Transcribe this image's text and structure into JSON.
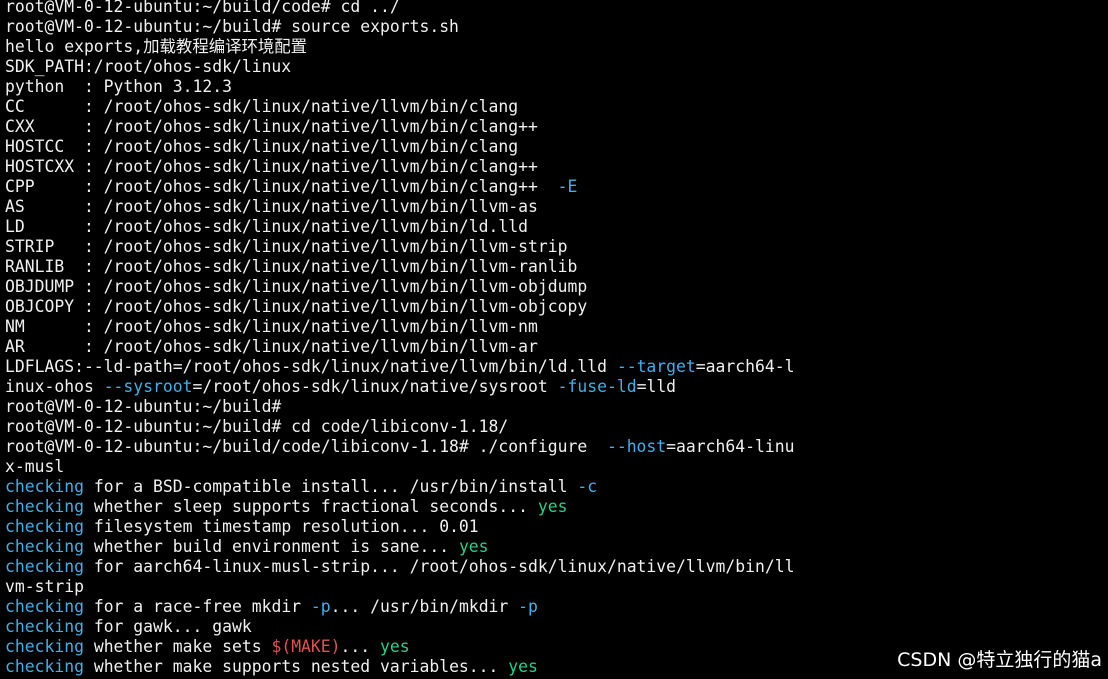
{
  "colors": {
    "background": "#000000",
    "text": "#f0f0f0",
    "option_flag": "#3fb0e8",
    "checking": "#3fb0e8",
    "yes_result": "#23d18b",
    "make_var": "#e05252"
  },
  "terminal": {
    "lines": [
      [
        {
          "t": "root@VM-0-12-ubuntu:~/build/code# cd ../",
          "c": "white"
        }
      ],
      [
        {
          "t": "root@VM-0-12-ubuntu:~/build# source exports.sh",
          "c": "white"
        }
      ],
      [
        {
          "t": "hello exports,加载教程编译环境配置",
          "c": "white"
        }
      ],
      [
        {
          "t": "SDK_PATH:/root/ohos-sdk/linux",
          "c": "white"
        }
      ],
      [
        {
          "t": "python  : Python 3.12.3",
          "c": "white"
        }
      ],
      [
        {
          "t": "CC      : /root/ohos-sdk/linux/native/llvm/bin/clang",
          "c": "white"
        }
      ],
      [
        {
          "t": "CXX     : /root/ohos-sdk/linux/native/llvm/bin/clang++",
          "c": "white"
        }
      ],
      [
        {
          "t": "HOSTCC  : /root/ohos-sdk/linux/native/llvm/bin/clang",
          "c": "white"
        }
      ],
      [
        {
          "t": "HOSTCXX : /root/ohos-sdk/linux/native/llvm/bin/clang++",
          "c": "white"
        }
      ],
      [
        {
          "t": "CPP     : /root/ohos-sdk/linux/native/llvm/bin/clang++  ",
          "c": "white"
        },
        {
          "t": "-E",
          "c": "blue"
        }
      ],
      [
        {
          "t": "AS      : /root/ohos-sdk/linux/native/llvm/bin/llvm-as",
          "c": "white"
        }
      ],
      [
        {
          "t": "LD      : /root/ohos-sdk/linux/native/llvm/bin/ld.lld",
          "c": "white"
        }
      ],
      [
        {
          "t": "STRIP   : /root/ohos-sdk/linux/native/llvm/bin/llvm-strip",
          "c": "white"
        }
      ],
      [
        {
          "t": "RANLIB  : /root/ohos-sdk/linux/native/llvm/bin/llvm-ranlib",
          "c": "white"
        }
      ],
      [
        {
          "t": "OBJDUMP : /root/ohos-sdk/linux/native/llvm/bin/llvm-objdump",
          "c": "white"
        }
      ],
      [
        {
          "t": "OBJCOPY : /root/ohos-sdk/linux/native/llvm/bin/llvm-objcopy",
          "c": "white"
        }
      ],
      [
        {
          "t": "NM      : /root/ohos-sdk/linux/native/llvm/bin/llvm-nm",
          "c": "white"
        }
      ],
      [
        {
          "t": "AR      : /root/ohos-sdk/linux/native/llvm/bin/llvm-ar",
          "c": "white"
        }
      ],
      [
        {
          "t": "LDFLAGS:--ld-path=/root/ohos-sdk/linux/native/llvm/bin/ld.lld ",
          "c": "white"
        },
        {
          "t": "--target",
          "c": "blue"
        },
        {
          "t": "=aarch64-l",
          "c": "white"
        }
      ],
      [
        {
          "t": "inux-ohos ",
          "c": "white"
        },
        {
          "t": "--sysroot",
          "c": "blue"
        },
        {
          "t": "=/root/ohos-sdk/linux/native/sysroot ",
          "c": "white"
        },
        {
          "t": "-fuse-ld",
          "c": "blue"
        },
        {
          "t": "=lld",
          "c": "white"
        }
      ],
      [
        {
          "t": "root@VM-0-12-ubuntu:~/build#",
          "c": "white"
        }
      ],
      [
        {
          "t": "root@VM-0-12-ubuntu:~/build# cd code/libiconv-1.18/",
          "c": "white"
        }
      ],
      [
        {
          "t": "root@VM-0-12-ubuntu:~/build/code/libiconv-1.18# ./configure  ",
          "c": "white"
        },
        {
          "t": "--host",
          "c": "blue"
        },
        {
          "t": "=aarch64-linu",
          "c": "white"
        }
      ],
      [
        {
          "t": "x-musl",
          "c": "white"
        }
      ],
      [
        {
          "t": "checking",
          "c": "blue"
        },
        {
          "t": " for a BSD-compatible install... /usr/bin/install ",
          "c": "white"
        },
        {
          "t": "-c",
          "c": "blue"
        }
      ],
      [
        {
          "t": "checking",
          "c": "blue"
        },
        {
          "t": " whether sleep supports fractional seconds... ",
          "c": "white"
        },
        {
          "t": "yes",
          "c": "green"
        }
      ],
      [
        {
          "t": "checking",
          "c": "blue"
        },
        {
          "t": " filesystem timestamp resolution... 0.01",
          "c": "white"
        }
      ],
      [
        {
          "t": "checking",
          "c": "blue"
        },
        {
          "t": " whether build environment is sane... ",
          "c": "white"
        },
        {
          "t": "yes",
          "c": "green"
        }
      ],
      [
        {
          "t": "checking",
          "c": "blue"
        },
        {
          "t": " for aarch64-linux-musl-strip... /root/ohos-sdk/linux/native/llvm/bin/ll",
          "c": "white"
        }
      ],
      [
        {
          "t": "vm-strip",
          "c": "white"
        }
      ],
      [
        {
          "t": "checking",
          "c": "blue"
        },
        {
          "t": " for a race-free mkdir ",
          "c": "white"
        },
        {
          "t": "-p",
          "c": "blue"
        },
        {
          "t": "... /usr/bin/mkdir ",
          "c": "white"
        },
        {
          "t": "-p",
          "c": "blue"
        }
      ],
      [
        {
          "t": "checking",
          "c": "blue"
        },
        {
          "t": " for gawk... gawk",
          "c": "white"
        }
      ],
      [
        {
          "t": "checking",
          "c": "blue"
        },
        {
          "t": " whether make sets ",
          "c": "white"
        },
        {
          "t": "$(MAKE)",
          "c": "red"
        },
        {
          "t": "... ",
          "c": "white"
        },
        {
          "t": "yes",
          "c": "green"
        }
      ],
      [
        {
          "t": "checking",
          "c": "blue"
        },
        {
          "t": " whether make supports nested variables... ",
          "c": "white"
        },
        {
          "t": "yes",
          "c": "green"
        }
      ]
    ]
  },
  "watermark": {
    "text": "CSDN @特立独行的猫a"
  }
}
